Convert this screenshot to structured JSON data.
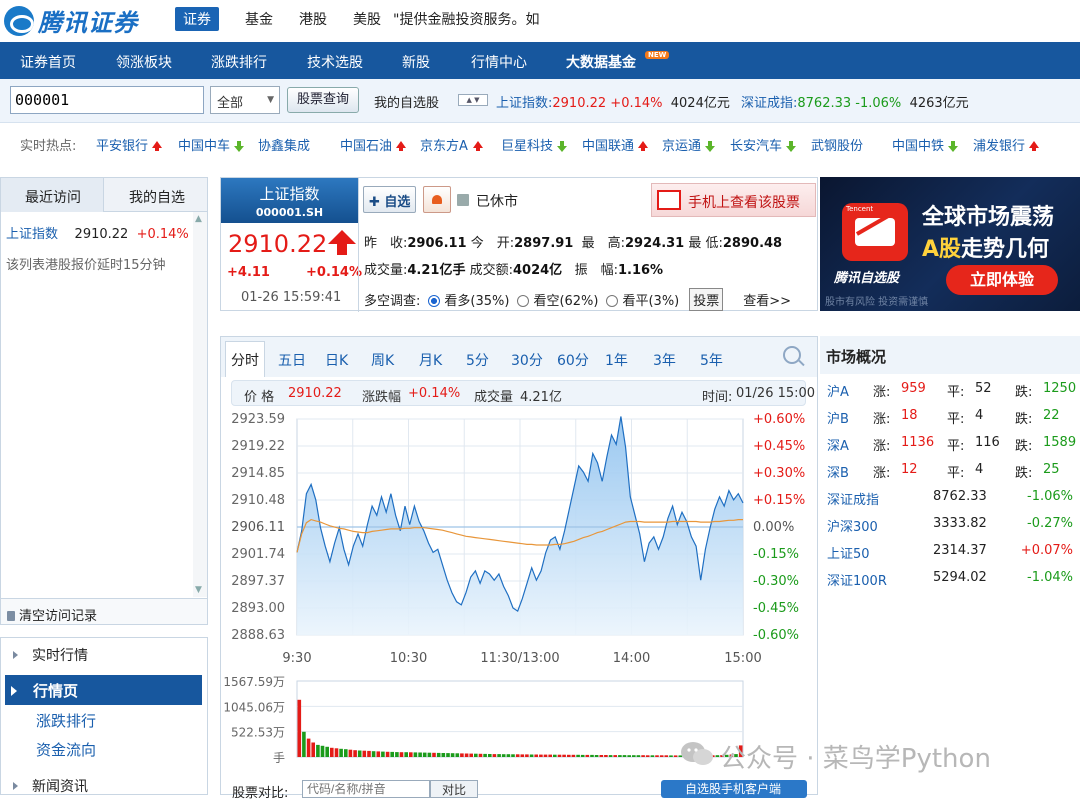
{
  "brand": {
    "logo_text": "腾讯证券"
  },
  "top_nav": {
    "items": [
      "证券",
      "基金",
      "港股",
      "美股"
    ],
    "notice": "\"提供金融投资服务。如"
  },
  "main_nav": {
    "items": [
      "证券首页",
      "领涨板块",
      "涨跌排行",
      "技术选股",
      "新股",
      "行情中心",
      "大数据基金"
    ],
    "new_badge": "NEW"
  },
  "search": {
    "code_value": "000001",
    "market_select": "全部",
    "query_button": "股票查询",
    "my_list": "我的自选股",
    "sh_label": "上证指数:",
    "sh_value": "2910.22",
    "sh_pct": "+0.14%",
    "sh_amount": "4024亿元",
    "sz_label": "深证成指:",
    "sz_value": "8762.33",
    "sz_pct": "-1.06%",
    "sz_amount": "4263亿元"
  },
  "hot": {
    "label": "实时热点:",
    "items": [
      {
        "name": "平安银行",
        "dir": "up"
      },
      {
        "name": "中国中车",
        "dir": "down"
      },
      {
        "name": "协鑫集成",
        "dir": ""
      },
      {
        "name": "中国石油",
        "dir": "up"
      },
      {
        "name": "京东方A",
        "dir": "up"
      },
      {
        "name": "巨星科技",
        "dir": "down"
      },
      {
        "name": "中国联通",
        "dir": "up"
      },
      {
        "name": "京运通",
        "dir": "down"
      },
      {
        "name": "长安汽车",
        "dir": "down"
      },
      {
        "name": "武钢股份",
        "dir": ""
      },
      {
        "name": "中国中铁",
        "dir": "down"
      },
      {
        "name": "浦发银行",
        "dir": "up"
      }
    ]
  },
  "left_panel": {
    "tabs": [
      "最近访问",
      "我的自选"
    ],
    "recent": {
      "name": "上证指数",
      "price": "2910.22",
      "pct": "+0.14%"
    },
    "note": "该列表港股报价延时15分钟",
    "clear": "清空访问记录"
  },
  "left_menu": {
    "section1": "实时行情",
    "active": "行情页",
    "links": [
      "涨跌排行",
      "资金流向"
    ],
    "section2": "新闻资讯"
  },
  "quote": {
    "name": "上证指数",
    "code": "000001.SH",
    "price": "2910.22",
    "change": "+4.11",
    "pct": "+0.14%",
    "time": "01-26 15:59:41",
    "add_button": "自选",
    "status": "已休市",
    "mobile_banner": "手机上查看该股票",
    "prev_close_label": "昨　收:",
    "prev_close": "2906.11",
    "open_label": "今　开:",
    "open": "2897.91",
    "high_label": "最　高:",
    "high": "2924.31",
    "low_label": "最 低:",
    "low": "2890.48",
    "vol_label": "成交量:",
    "vol": "4.21亿手",
    "amount_label": "成交额:",
    "amount": "4024亿",
    "amplitude_label": "振　幅:",
    "amplitude": "1.16%",
    "survey_label": "多空调查:",
    "survey_options": [
      "看多(35%)",
      "看空(62%)",
      "看平(3%)"
    ],
    "vote_button": "投票",
    "more": "查看>>"
  },
  "ad": {
    "tag": "Tencent",
    "brand": "腾讯自选股",
    "title1": "全球市场震荡",
    "title2_gold": "A股",
    "title2_rest": "走势几何",
    "cta": "立即体验",
    "small": "股市有风险 投资需谨慎"
  },
  "chart_tabs": [
    "分时",
    "五日",
    "日K",
    "周K",
    "月K",
    "5分",
    "30分",
    "60分",
    "1年",
    "3年",
    "5年"
  ],
  "info_bar": {
    "price_label": "价 格",
    "price": "2910.22",
    "pct_label": "涨跌幅",
    "pct": "+0.14%",
    "vol_label": "成交量",
    "vol": "4.21亿",
    "time_label": "时间:",
    "time": "01/26 15:00"
  },
  "chart_data": {
    "type": "area",
    "title": "",
    "y_ticks": [
      "2923.59",
      "2919.22",
      "2914.85",
      "2910.48",
      "2906.11",
      "2901.74",
      "2897.37",
      "2893.00",
      "2888.63"
    ],
    "pct_ticks": [
      "+0.60%",
      "+0.45%",
      "+0.30%",
      "+0.15%",
      "0.00%",
      "-0.15%",
      "-0.30%",
      "-0.45%",
      "-0.60%"
    ],
    "x_ticks": [
      "9:30",
      "10:30",
      "11:30/13:00",
      "14:00",
      "15:00"
    ],
    "ylim": [
      2888.63,
      2923.59
    ],
    "prev_close": 2906.11,
    "price": [
      2902.0,
      2905.5,
      2911.5,
      2913.0,
      2910.5,
      2906.0,
      2903.0,
      2900.5,
      2903.5,
      2906.0,
      2902.5,
      2900.0,
      2903.0,
      2905.0,
      2903.0,
      2906.5,
      2909.5,
      2908.0,
      2911.0,
      2908.5,
      2911.5,
      2908.0,
      2905.5,
      2909.5,
      2906.5,
      2909.5,
      2907.0,
      2905.5,
      2903.5,
      2902.0,
      2902.5,
      2900.0,
      2897.5,
      2895.5,
      2894.0,
      2893.5,
      2895.5,
      2898.0,
      2899.0,
      2897.0,
      2899.0,
      2898.5,
      2897.5,
      2898.5,
      2896.5,
      2895.0,
      2893.0,
      2892.5,
      2894.5,
      2897.0,
      2899.5,
      2897.5,
      2899.0,
      2902.0,
      2904.0,
      2904.5,
      2902.5,
      2905.5,
      2909.0,
      2912.5,
      2916.0,
      2915.0,
      2913.5,
      2918.0,
      2916.5,
      2913.5,
      2917.5,
      2921.0,
      2919.5,
      2924.0,
      2919.0,
      2911.0,
      2908.0,
      2905.0,
      2900.5,
      2903.5,
      2904.5,
      2902.5,
      2904.5,
      2907.5,
      2909.5,
      2906.5,
      2908.5,
      2907.0,
      2904.5,
      2903.0,
      2897.5,
      2902.5,
      2906.0,
      2909.0,
      2911.0,
      2909.5,
      2912.0,
      2910.5,
      2911.5,
      2910.0
    ],
    "avg": [
      2902.0,
      2905.0,
      2906.8,
      2907.3,
      2907.1,
      2906.9,
      2906.6,
      2906.3,
      2906.1,
      2905.9,
      2905.8,
      2905.6,
      2905.4,
      2905.3,
      2905.2,
      2905.2,
      2905.4,
      2905.5,
      2905.6,
      2905.7,
      2905.8,
      2905.8,
      2905.8,
      2905.9,
      2905.9,
      2906.0,
      2906.0,
      2906.0,
      2905.9,
      2905.8,
      2905.7,
      2905.6,
      2905.4,
      2905.2,
      2905.0,
      2904.8,
      2904.6,
      2904.5,
      2904.4,
      2904.3,
      2904.2,
      2904.1,
      2904.0,
      2903.9,
      2903.8,
      2903.7,
      2903.6,
      2903.5,
      2903.4,
      2903.3,
      2903.3,
      2903.2,
      2903.2,
      2903.2,
      2903.2,
      2903.3,
      2903.3,
      2903.4,
      2903.6,
      2903.8,
      2904.1,
      2904.4,
      2904.6,
      2904.9,
      2905.2,
      2905.4,
      2905.7,
      2906.0,
      2906.3,
      2906.6,
      2906.9,
      2907.0,
      2907.0,
      2907.0,
      2906.9,
      2906.9,
      2906.9,
      2906.9,
      2906.9,
      2906.9,
      2907.0,
      2907.0,
      2907.0,
      2907.0,
      2907.0,
      2907.0,
      2906.9,
      2906.9,
      2906.9,
      2907.0,
      2907.0,
      2907.1,
      2907.2,
      2907.2,
      2907.3,
      2907.3
    ],
    "vol_ticks": [
      "1567.59万",
      "1045.06万",
      "522.53万",
      "手"
    ],
    "vol_ylim": [
      0,
      1567.59
    ],
    "volume": [
      1180,
      520,
      380,
      300,
      250,
      230,
      210,
      190,
      180,
      170,
      160,
      150,
      140,
      135,
      130,
      125,
      120,
      115,
      112,
      108,
      105,
      102,
      100,
      98,
      96,
      94,
      92,
      90,
      88,
      86,
      84,
      82,
      80,
      78,
      76,
      74,
      72,
      70,
      68,
      66,
      64,
      62,
      60,
      60,
      58,
      58,
      56,
      56,
      54,
      54,
      52,
      52,
      50,
      50,
      50,
      48,
      48,
      48,
      46,
      46,
      46,
      44,
      44,
      44,
      42,
      42,
      42,
      40,
      40,
      40,
      40,
      38,
      38,
      38,
      38,
      36,
      36,
      36,
      36,
      36,
      34,
      34,
      34,
      34,
      34,
      34,
      34,
      34,
      34,
      36,
      38,
      42,
      46,
      52,
      60,
      240
    ],
    "volume_dir": [
      "u",
      "d",
      "u",
      "u",
      "d",
      "d",
      "d",
      "u",
      "u",
      "d",
      "d",
      "u",
      "u",
      "d",
      "u",
      "u",
      "d",
      "u",
      "d",
      "u",
      "d",
      "d",
      "u",
      "d",
      "u",
      "d",
      "d",
      "d",
      "d",
      "u",
      "d",
      "d",
      "d",
      "d",
      "d",
      "u",
      "u",
      "u",
      "d",
      "u",
      "d",
      "d",
      "u",
      "d",
      "d",
      "d",
      "d",
      "u",
      "u",
      "u",
      "d",
      "u",
      "u",
      "u",
      "u",
      "d",
      "u",
      "u",
      "u",
      "u",
      "d",
      "d",
      "u",
      "d",
      "d",
      "u",
      "u",
      "d",
      "u",
      "d",
      "d",
      "d",
      "d",
      "d",
      "u",
      "u",
      "d",
      "u",
      "u",
      "u",
      "d",
      "u",
      "d",
      "d",
      "d",
      "d",
      "u",
      "u",
      "u",
      "u",
      "d",
      "u",
      "d",
      "u",
      "d",
      "u"
    ]
  },
  "market": {
    "title": "市场概况",
    "breadth": [
      {
        "name": "沪A",
        "up_label": "涨:",
        "up": "959",
        "flat_label": "平:",
        "flat": "52",
        "down_label": "跌:",
        "down": "1250"
      },
      {
        "name": "沪B",
        "up_label": "涨:",
        "up": "18",
        "flat_label": "平:",
        "flat": "4",
        "down_label": "跌:",
        "down": "22"
      },
      {
        "name": "深A",
        "up_label": "涨:",
        "up": "1136",
        "flat_label": "平:",
        "flat": "116",
        "down_label": "跌:",
        "down": "1589"
      },
      {
        "name": "深B",
        "up_label": "涨:",
        "up": "12",
        "flat_label": "平:",
        "flat": "4",
        "down_label": "跌:",
        "down": "25"
      }
    ],
    "indices": [
      {
        "name": "深证成指",
        "value": "8762.33",
        "pct": "-1.06%",
        "dir": "down"
      },
      {
        "name": "沪深300",
        "value": "3333.82",
        "pct": "-0.27%",
        "dir": "down"
      },
      {
        "name": "上证50",
        "value": "2314.37",
        "pct": "+0.07%",
        "dir": "up"
      },
      {
        "name": "深证100R",
        "value": "5294.02",
        "pct": "-1.04%",
        "dir": "down"
      }
    ]
  },
  "bottom": {
    "compare_label": "股票对比:",
    "compare_placeholder": "代码/名称/拼音",
    "compare_button": "对比",
    "app_ad": "自选股手机客户端"
  },
  "watermark": "公众号 · 菜鸟学Python"
}
